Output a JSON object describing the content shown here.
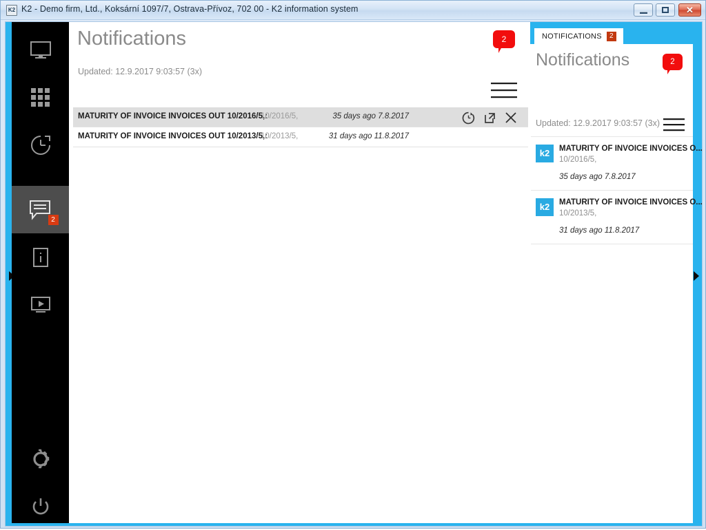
{
  "window": {
    "title": "K2 - Demo firm, Ltd., Koksární 1097/7, Ostrava-Přívoz, 702 00 - K2 information system",
    "icon_label": "K2",
    "controls": {
      "minimize_label": "Minimize",
      "maximize_label": "Maximize",
      "close_label": "✕"
    }
  },
  "colors": {
    "accent_cyan": "#29b3ee",
    "badge_red": "#f20d0d",
    "badge_dark_red": "#c2390f",
    "sidebar_black": "#000000",
    "sidebar_active": "#4d4d4d",
    "k2_blue": "#29aae2",
    "row_selected": "#dedede"
  },
  "sidebar": {
    "items": [
      {
        "name": "dashboard",
        "icon": "monitor-icon",
        "active": false,
        "badge": ""
      },
      {
        "name": "modules",
        "icon": "grid-apps-icon",
        "active": false,
        "badge": ""
      },
      {
        "name": "history",
        "icon": "clock-history-icon",
        "active": false,
        "badge": ""
      },
      {
        "name": "notifications",
        "icon": "chat-bubble-icon",
        "active": true,
        "badge": "2"
      },
      {
        "name": "information",
        "icon": "info-icon",
        "active": false,
        "badge": ""
      },
      {
        "name": "media",
        "icon": "video-play-icon",
        "active": false,
        "badge": ""
      }
    ],
    "bottom_items": [
      {
        "name": "settings",
        "icon": "gear-icon"
      },
      {
        "name": "power",
        "icon": "power-icon"
      }
    ]
  },
  "main": {
    "title": "Notifications",
    "badge_count": "2",
    "updated": "Updated: 12.9.2017 9:03:57 (3x)",
    "menu_icon": "hamburger-menu-icon",
    "rows": [
      {
        "title": "MATURITY OF INVOICE INVOICES OUT 10/2016/5,:",
        "subtitle": "10/2016/5,",
        "time": "35 days ago 7.8.2017",
        "selected": true,
        "actions": [
          "snooze-icon",
          "open-in-new-window-icon",
          "close-icon"
        ]
      },
      {
        "title": "MATURITY OF INVOICE INVOICES OUT 10/2013/5,:",
        "subtitle": "10/2013/5,",
        "time": "31 days ago 11.8.2017",
        "selected": false,
        "actions": []
      }
    ]
  },
  "panel": {
    "tab_label": "NOTIFICATIONS",
    "tab_badge": "2",
    "title": "Notifications",
    "badge_count": "2",
    "updated": "Updated: 12.9.2017 9:03:57 (3x)",
    "menu_icon": "hamburger-menu-icon",
    "items": [
      {
        "icon_label": "k2",
        "title": "MATURITY OF INVOICE INVOICES O...",
        "subtitle": "10/2016/5,",
        "time": "35 days ago 7.8.2017"
      },
      {
        "icon_label": "k2",
        "title": "MATURITY OF INVOICE INVOICES O...",
        "subtitle": "10/2013/5,",
        "time": "31 days ago 11.8.2017"
      }
    ]
  },
  "edges": {
    "left_arrow": "expand-left-panel-arrow",
    "right_arrow": "expand-right-panel-arrow"
  }
}
